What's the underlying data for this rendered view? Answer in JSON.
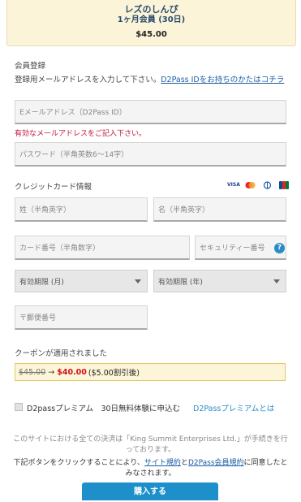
{
  "plan": {
    "name": "レズのしんぴ",
    "duration": "1ヶ月会員 (30日)",
    "price": "$45.00"
  },
  "registration": {
    "heading": "会員登録",
    "instruction": "登録用メールアドレスを入力して下さい。",
    "d2pass_link": "D2Pass IDをお持ちのかたはコチラ",
    "email_placeholder": "Eメールアドレス（D2Pass ID）",
    "email_error": "有効なメールアドレスをご記入下さい。",
    "password_placeholder": "パスワード（半角英数6〜14字）"
  },
  "credit_card": {
    "heading": "クレジットカード情報",
    "brands": [
      "VISA",
      "Mastercard",
      "Diners",
      "JCB"
    ],
    "last_name_placeholder": "姓（半角英字）",
    "first_name_placeholder": "名（半角英字）",
    "card_number_placeholder": "カード番号（半角数字）",
    "security_code_placeholder": "セキュリティー番号",
    "help_icon": "?",
    "expiry_month": "有効期限 (月)",
    "expiry_year": "有効期限 (年)",
    "postal_placeholder": "〒郵便番号"
  },
  "coupon": {
    "applied_text": "クーポンが適用されました",
    "old_price": "$45.00",
    "arrow": "→",
    "new_price": "$40.00",
    "discount_note": "($5.00割引後)"
  },
  "premium": {
    "label": "D2passプレミアム　30日無料体験に申込む",
    "link": "D2Passプレミアムとは"
  },
  "notes": {
    "line1": "このサイトにおける全ての決済は「King Summit Enterprises Ltd.」が手続きを行っております。",
    "line2_prefix": "下記ボタンをクリックすることにより、",
    "terms_link": "サイト規約",
    "and": "と",
    "d2pass_terms_link": "D2Pass会員規約",
    "line2_suffix": "に同意したとみなされます。"
  },
  "buy_button": "購入する",
  "colors": {
    "accent": "#1d8fcb",
    "error": "#c0143c",
    "coupon_bg": "#fdf5d8",
    "new_price": "#d1121a",
    "link": "#1a5da6"
  }
}
